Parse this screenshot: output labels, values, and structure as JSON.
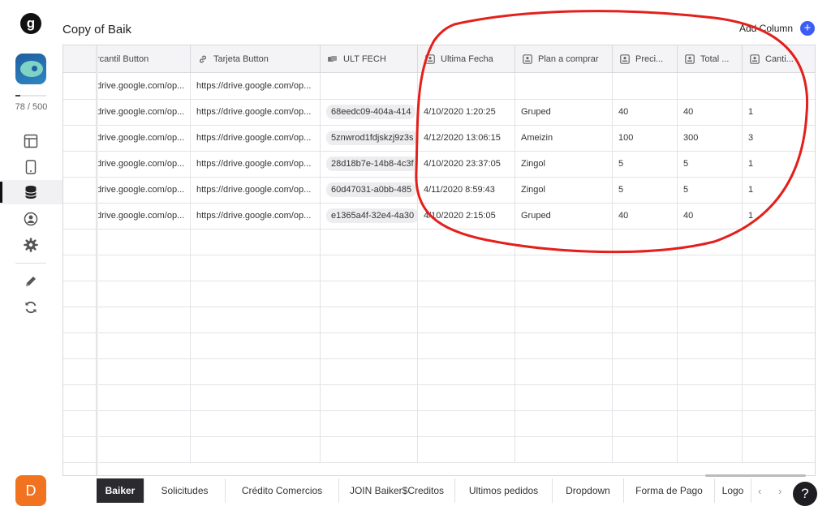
{
  "sidebar": {
    "logo_letter": "g",
    "usage_text": "78 / 500",
    "usage_fraction": 0.156,
    "nav_icons": [
      "layout-icon",
      "phone-icon",
      "database-icon",
      "user-circle-icon",
      "gear-icon",
      "pencil-icon",
      "refresh-icon"
    ],
    "avatar_letter": "D"
  },
  "header": {
    "title": "Copy of Baik",
    "add_column_label": "Add Column",
    "add_icon": "+"
  },
  "grid": {
    "columns": [
      {
        "label": "rcantil Button",
        "icon": ""
      },
      {
        "label": "Tarjeta Button",
        "icon": "link-icon"
      },
      {
        "label": "ULT FECH",
        "icon": "hash-icon"
      },
      {
        "label": "Ultima Fecha",
        "icon": "field-icon"
      },
      {
        "label": "Plan a comprar",
        "icon": "field-icon"
      },
      {
        "label": "Preci...",
        "icon": "field-icon"
      },
      {
        "label": "Total ...",
        "icon": "field-icon"
      },
      {
        "label": "Canti...",
        "icon": "field-icon"
      }
    ],
    "rows": [
      [
        "drive.google.com/op...",
        "https://drive.google.com/op...",
        "",
        "",
        "",
        "",
        "",
        ""
      ],
      [
        "drive.google.com/op...",
        "https://drive.google.com/op...",
        "68eedc09-404a-414",
        "4/10/2020 1:20:25",
        "Gruped",
        "40",
        "40",
        "1"
      ],
      [
        "drive.google.com/op...",
        "https://drive.google.com/op...",
        "5znwrod1fdjskzj9z3s",
        "4/12/2020 13:06:15",
        "Ameizin",
        "100",
        "300",
        "3"
      ],
      [
        "drive.google.com/op...",
        "https://drive.google.com/op...",
        "28d18b7e-14b8-4c3f",
        "4/10/2020 23:37:05",
        "Zingol",
        "5",
        "5",
        "1"
      ],
      [
        "drive.google.com/op...",
        "https://drive.google.com/op...",
        "60d47031-a0bb-485",
        "4/11/2020 8:59:43",
        "Zingol",
        "5",
        "5",
        "1"
      ],
      [
        "drive.google.com/op...",
        "https://drive.google.com/op...",
        "e1365a4f-32e4-4a30",
        "4/10/2020 2:15:05",
        "Gruped",
        "40",
        "40",
        "1"
      ]
    ]
  },
  "tabs": {
    "items": [
      "Baiker",
      "Solicitudes",
      "Crédito Comercios",
      "JOIN Baiker$Creditos",
      "Ultimos pedidos",
      "Dropdown",
      "Forma de Pago",
      "Logo"
    ],
    "active": "Baiker",
    "prev_arrow": "‹",
    "next_arrow": "›"
  },
  "help_label": "?",
  "colors": {
    "accent": "#3d5cf5",
    "avatar": "#f2731f",
    "annotation": "#e3201b"
  }
}
